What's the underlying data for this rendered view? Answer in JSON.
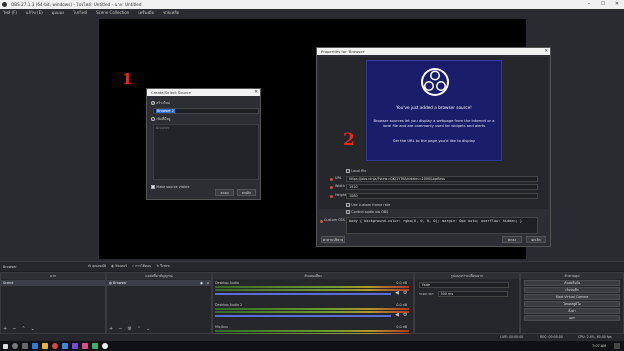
{
  "window": {
    "title": "OBS 27.1.3 (64-bit, windows) - โปรไฟล์: Untitled - ฉาก: Untitled",
    "min": "–",
    "max": "☐",
    "close": "✕"
  },
  "menu": [
    "ไฟล์ (F)",
    "แก้ไข (E)",
    "มุมมอง",
    "โปรไฟล์",
    "Scene Collection",
    "เครื่องมือ",
    "ช่วยเหลือ"
  ],
  "annotations": {
    "one": "1",
    "two": "2"
  },
  "create_source": {
    "title": "Create/Select Source",
    "close": "✕",
    "create_new": "สร้างใหม่",
    "new_name": "Browser 2",
    "add_existing": "เพิ่มที่มีอยู่",
    "existing_item": "Browser",
    "make_visible": "Make source visible",
    "ok": "ตกลง",
    "cancel": "ยกเลิก"
  },
  "browser_props": {
    "title": "Properties for 'Browser'",
    "close": "✕",
    "banner_heading": "You've just added a browser source!",
    "banner_text": "Browser sources let you display a webpage from the internet or a local file and are commonly used for widgets and alerts",
    "banner_cta": "Set the URL to the page you'd like to display",
    "local_file": "Local file",
    "url_label": "URL",
    "url_value": "https://obs.ninja/?view=QKJ1YT6&hidebn=2000&bpfless",
    "width_label": "Width",
    "width_value": "1920",
    "height_label": "Height",
    "height_value": "1080",
    "custom_fps": "Use custom frame rate",
    "control_audio": "Control audio via OBS",
    "css_label": "Custom CSS",
    "css_value": "body { background-color: rgba(0, 0, 0, 0); margin: 0px auto; overflow: hidden; }",
    "defaults": "ค่าตามปริยาย",
    "ok": "ตกลง",
    "cancel": "ยกเลิก"
  },
  "source_toolbar": {
    "name": "Browser",
    "properties": "คุณสมบัติ",
    "filters": "ฟิลเตอร์",
    "interact": "การโต้ตอบ",
    "refresh": "รีเฟรช"
  },
  "scenes": {
    "header": "ฉาก",
    "items": [
      "Scene"
    ]
  },
  "sources": {
    "header": "แหล่งที่มาสัญญาณ",
    "items": [
      "Browser"
    ]
  },
  "mixer": {
    "header": "ตัวผสมเสียง",
    "channels": [
      {
        "name": "Desktop Audio",
        "db": "0.0 dB"
      },
      {
        "name": "Desktop Audio 2",
        "db": "0.0 dB"
      },
      {
        "name": "Mic/Aux",
        "db": "0.0 dB"
      }
    ]
  },
  "transitions": {
    "header": "รูปแบบการเปลี่ยนฉาก",
    "type": "Fade",
    "duration_label": "ระยะเวลา",
    "duration": "300 ms"
  },
  "controls": {
    "header": "ตัวควบคุม",
    "buttons": [
      "เริ่มสตรีมมิ่ง",
      "เริ่มบันทึก",
      "Start Virtual Camera",
      "โหมดสตูดิโอ",
      "ตั้งค่า",
      "ออก"
    ]
  },
  "status": {
    "live": "LIVE: 00:00:00",
    "rec": "REC: 00:00:00",
    "cpu": "CPU: 2.4%, 60.00 fps",
    "dropped": "FPS: (0/0) 00:00:00"
  },
  "taskbar": {
    "clock": "7:07 AM"
  }
}
